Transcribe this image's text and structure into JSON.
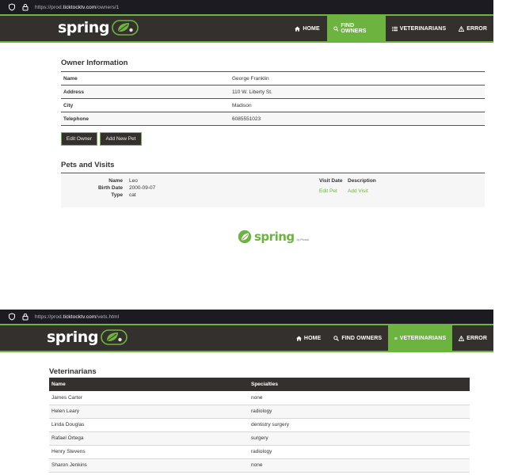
{
  "owner_page": {
    "url": {
      "prefix": "https://prod.",
      "host": "ticktocktv.com",
      "path": "/owners/1"
    },
    "brand": "spring",
    "nav": [
      {
        "label": "Home",
        "icon": "home-icon"
      },
      {
        "label": "Find owners",
        "icon": "search-icon"
      },
      {
        "label": "Veterinarians",
        "icon": "list-icon"
      },
      {
        "label": "Error",
        "icon": "warning-icon"
      }
    ],
    "active_nav": "Find owners",
    "title": "Owner Information",
    "owner": [
      {
        "label": "Name",
        "value": "George Franklin"
      },
      {
        "label": "Address",
        "value": "110 W. Liberty St."
      },
      {
        "label": "City",
        "value": "Madison"
      },
      {
        "label": "Telephone",
        "value": "6085551023"
      }
    ],
    "buttons": {
      "edit": "Edit Owner",
      "add_pet": "Add New Pet"
    },
    "pets_title": "Pets and Visits",
    "pet": {
      "name_label": "Name",
      "name": "Leo",
      "birth_label": "Birth Date",
      "birth": "2000-09-07",
      "type_label": "Type",
      "type": "cat"
    },
    "visits": {
      "date_header": "Visit Date",
      "desc_header": "Description",
      "edit_pet": "Edit Pet",
      "add_visit": "Add Visit"
    },
    "footer": {
      "brand": "spring",
      "by": "by Pivotal."
    }
  },
  "vets_page": {
    "url": {
      "prefix": "https://prod.",
      "host": "ticktocktv.com",
      "path": "/vets.html"
    },
    "brand": "spring",
    "nav": [
      {
        "label": "Home",
        "icon": "home-icon"
      },
      {
        "label": "Find owners",
        "icon": "search-icon"
      },
      {
        "label": "Veterinarians",
        "icon": "list-icon"
      },
      {
        "label": "Error",
        "icon": "warning-icon"
      }
    ],
    "active_nav": "Veterinarians",
    "title": "Veterinarians",
    "columns": [
      "Name",
      "Specialties"
    ],
    "rows": [
      [
        "James Carter",
        "none"
      ],
      [
        "Helen Leary",
        "radiology"
      ],
      [
        "Linda Douglas",
        "dentistry surgery"
      ],
      [
        "Rafael Ortega",
        "surgery"
      ],
      [
        "Henry Stevens",
        "radiology"
      ],
      [
        "Sharon Jenkins",
        "none"
      ]
    ]
  },
  "colors": {
    "brand_green": "#6db33f",
    "navbar_bg": "#34302d",
    "browser_bar": "#1c1b22"
  }
}
